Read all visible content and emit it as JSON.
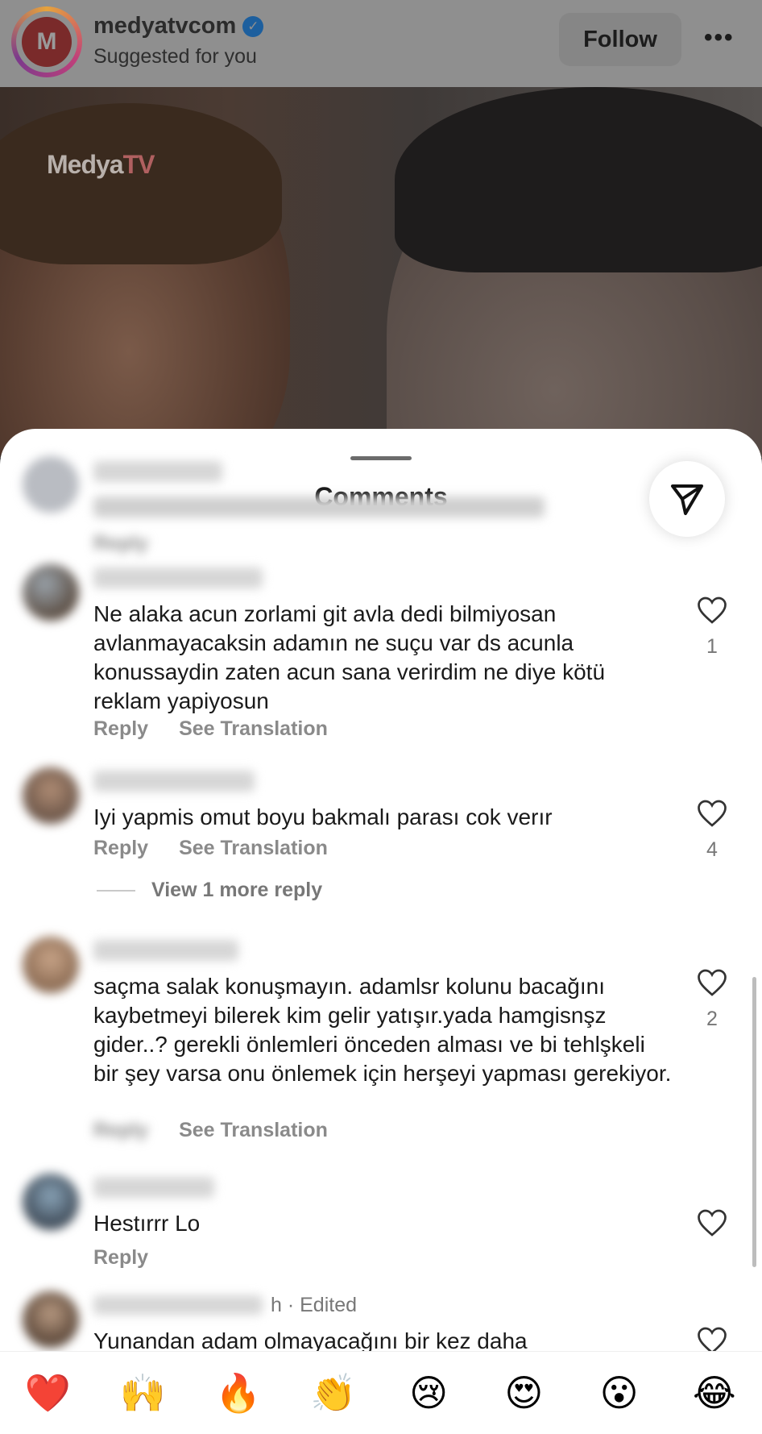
{
  "post_header": {
    "username": "medyatvcom",
    "subtitle": "Suggested for you",
    "follow_label": "Follow",
    "more_label": "•••",
    "avatar_letter": "M"
  },
  "post_image": {
    "watermark_main": "Medya",
    "watermark_tv": "TV"
  },
  "comments_sheet": {
    "title": "Comments",
    "comments": [
      {
        "user": "",
        "text": "",
        "reply": "Reply",
        "blurred": true
      },
      {
        "user": "",
        "text": "Ne alaka acun zorlami git avla dedi bilmiyosan avlanmayacaksin adamın ne suçu var ds acunla konussaydin zaten acun sana verirdim ne diye kötü reklam yapiyosun",
        "reply": "Reply",
        "translate": "See Translation",
        "likes": "1"
      },
      {
        "user": "",
        "text": "Iyi yapmis omut boyu bakmalı parası cok verır",
        "reply": "Reply",
        "translate": "See Translation",
        "likes": "4",
        "view_more": "View 1 more reply"
      },
      {
        "user": "",
        "text": "saçma salak konuşmayın. adamlsr kolunu bacağını kaybetmeyi bilerek kim gelir yatışır.yada hamgisnşz gider..? gerekli önlemleri önceden alması ve bi tehlşkeli bir şey varsa onu önlemek için herşeyi yapması gerekiyor.",
        "reply": "Reply",
        "translate": "See Translation",
        "likes": "2"
      },
      {
        "user": "",
        "text": "Hestırrr Lo",
        "reply": "Reply"
      },
      {
        "user": "",
        "meta": "h · Edited",
        "text": "Yunandan adam olmayacağını bir kez daha"
      }
    ]
  },
  "emoji_bar": {
    "emojis": [
      "❤️",
      "🙌",
      "🔥",
      "👏",
      "😢",
      "😍",
      "😮",
      "😂"
    ]
  },
  "colors": {
    "accent_verified": "#1d9bf0",
    "follow_bg": "#efefef",
    "heart_red": "#e0245e"
  }
}
